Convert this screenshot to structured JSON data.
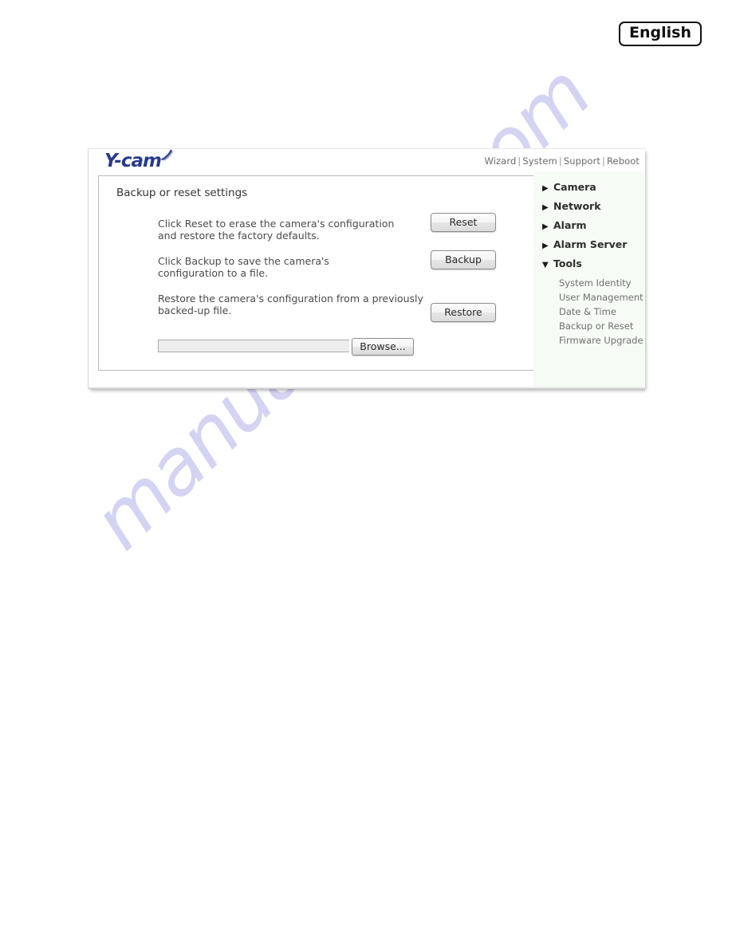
{
  "language_badge": {
    "label": "English"
  },
  "watermark": {
    "text": "manualshive.com"
  },
  "panel": {
    "logo": {
      "text": "Y-cam",
      "icon": "wifi-signal-icon"
    },
    "top_nav": {
      "separator": "|",
      "items": [
        {
          "label": "Wizard"
        },
        {
          "label": "System"
        },
        {
          "label": "Support"
        },
        {
          "label": "Reboot"
        }
      ]
    },
    "content": {
      "title": "Backup or reset settings",
      "rows": [
        {
          "text": "Click Reset to erase the camera's configuration\nand restore the factory defaults.",
          "button": "Reset"
        },
        {
          "text": "Click Backup to save the camera's\nconfiguration to a file.",
          "button": "Backup"
        },
        {
          "text": "Restore the camera's configuration from a previously\nbacked-up file.",
          "button": "Restore"
        }
      ],
      "file_field": {
        "value": "",
        "placeholder": "",
        "browse_label": "Browse..."
      }
    },
    "sidebar": {
      "groups": [
        {
          "label": "Camera",
          "arrow": "collapsed-arrow-icon",
          "expanded": false
        },
        {
          "label": "Network",
          "arrow": "collapsed-arrow-icon",
          "expanded": false
        },
        {
          "label": "Alarm",
          "arrow": "collapsed-arrow-icon",
          "expanded": false
        },
        {
          "label": "Alarm Server",
          "arrow": "collapsed-arrow-icon",
          "expanded": false
        },
        {
          "label": "Tools",
          "arrow": "expanded-arrow-icon",
          "expanded": true
        }
      ],
      "tools_items": [
        {
          "label": "System Identity"
        },
        {
          "label": "User Management"
        },
        {
          "label": "Date & Time"
        },
        {
          "label": "Backup or Reset"
        },
        {
          "label": "Firmware Upgrade"
        }
      ]
    }
  },
  "colors": {
    "logo_blue": "#283c8c",
    "sidebar_bg": "#f6fbf5",
    "watermark": "#c9c7ef",
    "body_text": "#4a4a4a"
  }
}
